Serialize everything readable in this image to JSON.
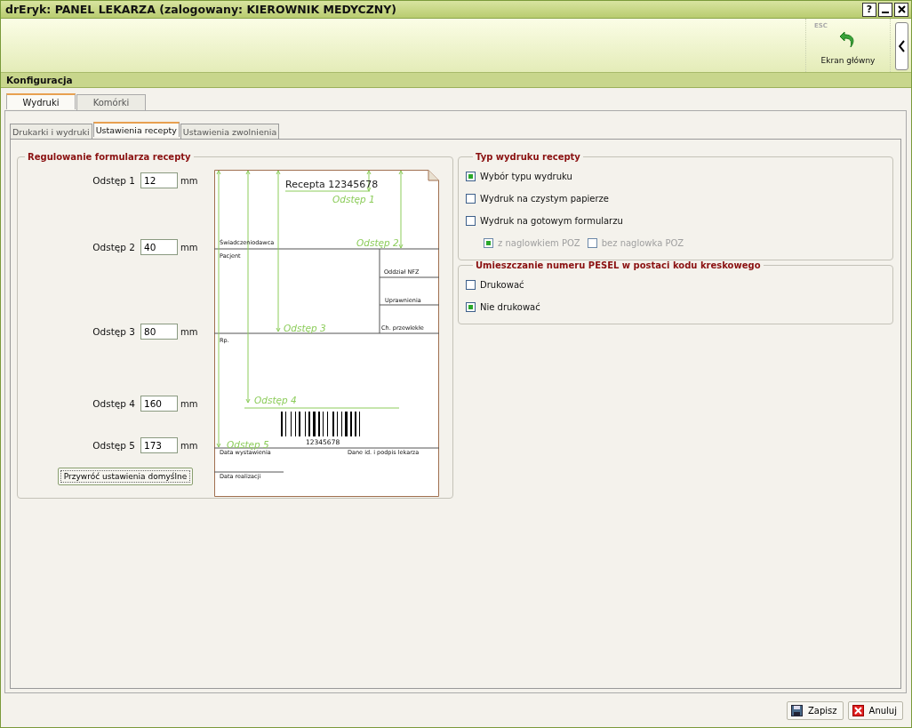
{
  "window": {
    "title": "drEryk: PANEL LEKARZA (zalogowany: KIEROWNIK MEDYCZNY)",
    "controls": [
      "?"
    ]
  },
  "toolbar": {
    "esc_hint": "ESC",
    "home_button": "Ekran główny"
  },
  "section_title": "Konfiguracja",
  "tabs": [
    {
      "label": "Wydruki",
      "selected": true
    },
    {
      "label": "Komórki",
      "selected": false
    }
  ],
  "subtabs": [
    {
      "label": "Drukarki i wydruki",
      "selected": false
    },
    {
      "label": "Ustawienia recepty",
      "selected": true
    },
    {
      "label": "Ustawienia zwolnienia",
      "selected": false
    }
  ],
  "form_adjust": {
    "title": "Regulowanie formularza recepty",
    "fields": [
      {
        "label": "Odstęp 1",
        "value": "12",
        "unit": "mm"
      },
      {
        "label": "Odstęp 2",
        "value": "40",
        "unit": "mm"
      },
      {
        "label": "Odstęp 3",
        "value": "80",
        "unit": "mm"
      },
      {
        "label": "Odstęp 4",
        "value": "160",
        "unit": "mm"
      },
      {
        "label": "Odstęp 5",
        "value": "173",
        "unit": "mm"
      }
    ],
    "reset_button": "Przywróć ustawienia domyślne",
    "preview": {
      "header": "Recepta 12345678",
      "barcode_number": "12345678",
      "labels": [
        "Świadczeniodawca",
        "Pacjent",
        "Oddział NFZ",
        "Uprawnienia",
        "Ch. przewlekłe",
        "Rp.",
        "Data wystawienia",
        "Dane id. i podpis lekarza",
        "Data realizacji"
      ],
      "markers": [
        "Odstęp 1",
        "Odstęp 2",
        "Odstęp 3",
        "Odstęp 4",
        "Odstęp 5"
      ]
    }
  },
  "print_type": {
    "title": "Typ wydruku recepty",
    "options": [
      {
        "label": "Wybór typu wydruku",
        "checked": true
      },
      {
        "label": "Wydruk na czystym papierze",
        "checked": false
      },
      {
        "label": "Wydruk na gotowym formularzu",
        "checked": false
      }
    ],
    "sub_options": [
      {
        "label": "z naglowkiem POZ",
        "checked": true,
        "disabled": true
      },
      {
        "label": "bez naglowka POZ",
        "checked": false,
        "disabled": true
      }
    ]
  },
  "pesel": {
    "title": "Umieszczanie numeru PESEL w postaci kodu kreskowego",
    "options": [
      {
        "label": "Drukować",
        "checked": false
      },
      {
        "label": "Nie drukować",
        "checked": true
      }
    ]
  },
  "footer": {
    "buttons": [
      {
        "kind": "save",
        "label": "Zapisz"
      },
      {
        "kind": "cancel",
        "label": "Anuluj"
      }
    ]
  }
}
